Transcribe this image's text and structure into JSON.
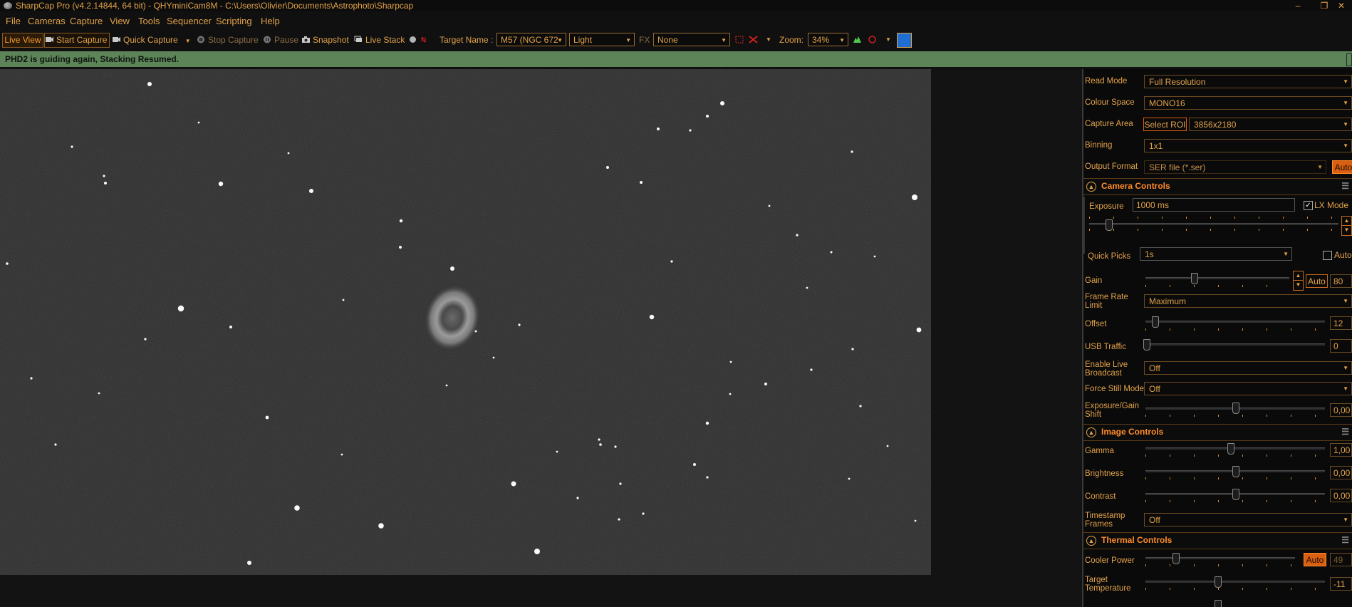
{
  "window": {
    "title": "SharpCap Pro (v4.2.14844, 64 bit) - QHYminiCam8M - C:\\Users\\Olivier\\Documents\\Astrophoto\\Sharpcap",
    "min_glyph": "–",
    "max_glyph": "❐",
    "close_glyph": "✕"
  },
  "menu": [
    "File",
    "Cameras",
    "Capture",
    "View",
    "Tools",
    "Sequencer",
    "Scripting",
    "Help"
  ],
  "toolbar": {
    "live_view": "Live View",
    "start_capture": "Start Capture",
    "quick_capture": "Quick Capture",
    "stop_capture": "Stop Capture",
    "pause": "Pause",
    "snapshot": "Snapshot",
    "live_stack": "Live Stack",
    "target_label": "Target Name :",
    "target_value": "M57 (NGC 672",
    "frame_type": "Light",
    "fx_label": "FX",
    "fx_value": "None",
    "zoom_label": "Zoom:",
    "zoom_value": "34%"
  },
  "status": {
    "message": "PHD2 is guiding again, Stacking Resumed.",
    "bg_color": "#5d8459"
  },
  "panel": {
    "read_mode": {
      "label": "Read Mode",
      "value": "Full Resolution"
    },
    "colour_space": {
      "label": "Colour Space",
      "value": "MONO16"
    },
    "capture_area": {
      "label": "Capture Area",
      "button": "Select ROI",
      "value": "3856x2180"
    },
    "binning": {
      "label": "Binning",
      "value": "1x1"
    },
    "output_format": {
      "label": "Output Format",
      "value": "SER file (*.ser)",
      "auto": "Auto"
    },
    "camera_controls": {
      "title": "Camera Controls",
      "exposure_label": "Exposure",
      "exposure_value": "1000 ms",
      "lx_mode": "LX Mode",
      "quick_picks_label": "Quick Picks",
      "quick_picks_value": "1s",
      "auto": "Auto",
      "gain_label": "Gain",
      "gain_auto": "Auto",
      "gain_value": "80",
      "frame_rate_label_1": "Frame Rate",
      "frame_rate_label_2": "Limit",
      "frame_rate_value": "Maximum",
      "offset_label": "Offset",
      "offset_value": "12",
      "usb_label": "USB Traffic",
      "usb_value": "0",
      "broadcast_label_1": "Enable Live",
      "broadcast_label_2": "Broadcast",
      "broadcast_value": "Off",
      "still_label": "Force Still Mode",
      "still_value": "Off",
      "shift_label_1": "Exposure/Gain",
      "shift_label_2": "Shift",
      "shift_value": "0,00"
    },
    "image_controls": {
      "title": "Image Controls",
      "gamma_label": "Gamma",
      "gamma_value": "1,00",
      "brightness_label": "Brightness",
      "brightness_value": "0,00",
      "contrast_label": "Contrast",
      "contrast_value": "0,00",
      "timestamp_label_1": "Timestamp",
      "timestamp_label_2": "Frames",
      "timestamp_value": "Off"
    },
    "thermal_controls": {
      "title": "Thermal Controls",
      "cooler_label": "Cooler Power",
      "cooler_auto": "Auto",
      "cooler_value": "49",
      "target_label_1": "Target",
      "target_label_2": "Temperature",
      "target_value": "-11"
    }
  },
  "colors": {
    "accent": "#e2a24a",
    "highlight": "#d95f12",
    "panel_bg": "#0a0a0a"
  }
}
